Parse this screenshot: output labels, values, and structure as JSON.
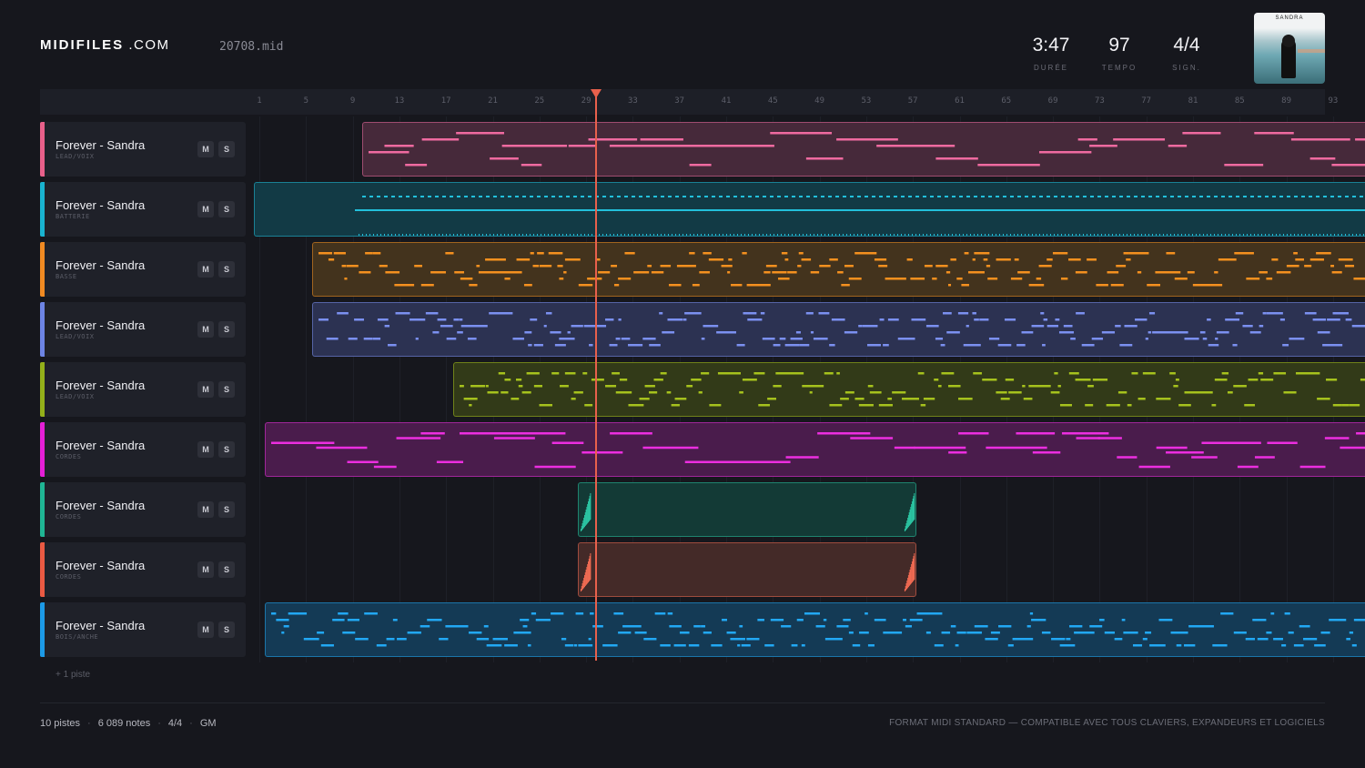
{
  "header": {
    "logo_main": "MIDIFILES",
    "logo_suffix": ".COM",
    "filename": "20708.mid",
    "stats": [
      {
        "value": "3:47",
        "label": "DURÉE"
      },
      {
        "value": "97",
        "label": "TEMPO"
      },
      {
        "value": "4/4",
        "label": "SIGN."
      }
    ],
    "cover_text": "SANDRA"
  },
  "ruler": {
    "ticks": [
      "1",
      "5",
      "9",
      "13",
      "17",
      "21",
      "25",
      "29",
      "33",
      "37",
      "41",
      "45",
      "49",
      "53",
      "57",
      "61",
      "65",
      "69",
      "73",
      "77",
      "81",
      "85",
      "89",
      "93"
    ]
  },
  "playhead": {
    "bar": 29.6
  },
  "tracks": [
    {
      "name": "Forever - Sandra",
      "sub": "LEAD/VOIX",
      "color": "#e8608a",
      "clip_color": "#ef6aa0",
      "clip_bg": "#46293a",
      "m_label": "M",
      "s_label": "S"
    },
    {
      "name": "Forever - Sandra",
      "sub": "BATTERIE",
      "color": "#19b3cf",
      "clip_color": "#22c0dc",
      "clip_bg": "#123a45",
      "m_label": "M",
      "s_label": "S"
    },
    {
      "name": "Forever - Sandra",
      "sub": "BASSE",
      "color": "#f08a22",
      "clip_color": "#f4901f",
      "clip_bg": "#43331d",
      "m_label": "M",
      "s_label": "S"
    },
    {
      "name": "Forever - Sandra",
      "sub": "LEAD/VOIX",
      "color": "#6d84e4",
      "clip_color": "#7b90f0",
      "clip_bg": "#2c3252",
      "m_label": "M",
      "s_label": "S"
    },
    {
      "name": "Forever - Sandra",
      "sub": "LEAD/VOIX",
      "color": "#93b01a",
      "clip_color": "#a6c21d",
      "clip_bg": "#323a18",
      "m_label": "M",
      "s_label": "S"
    },
    {
      "name": "Forever - Sandra",
      "sub": "CORDES",
      "color": "#e51fd6",
      "clip_color": "#ec2ee0",
      "clip_bg": "#4a1c4c",
      "m_label": "M",
      "s_label": "S"
    },
    {
      "name": "Forever - Sandra",
      "sub": "CORDES",
      "color": "#1fb594",
      "clip_color": "#2bc4a2",
      "clip_bg": "#133a36",
      "m_label": "M",
      "s_label": "S"
    },
    {
      "name": "Forever - Sandra",
      "sub": "CORDES",
      "color": "#ea5a43",
      "clip_color": "#f06a52",
      "clip_bg": "#442a28",
      "m_label": "M",
      "s_label": "S"
    },
    {
      "name": "Forever - Sandra",
      "sub": "BOIS/ANCHE",
      "color": "#1c9ae6",
      "clip_color": "#22a8f4",
      "clip_bg": "#143a55",
      "m_label": "M",
      "s_label": "S"
    }
  ],
  "more_tracks": "+ 1 piste",
  "footer": {
    "tracks": "10 pistes",
    "notes": "6 089 notes",
    "sig": "4/4",
    "gm": "GM",
    "sep": "·",
    "right": "FORMAT MIDI STANDARD — COMPATIBLE AVEC TOUS CLAVIERS, EXPANDEURS ET LOGICIELS"
  }
}
